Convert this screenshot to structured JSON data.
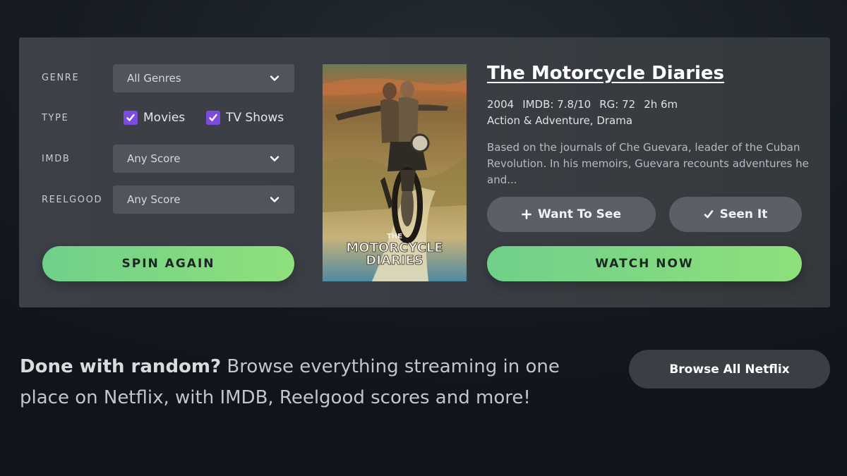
{
  "filters": {
    "genre": {
      "label": "GENRE",
      "value": "All Genres"
    },
    "type": {
      "label": "TYPE",
      "options": [
        {
          "label": "Movies",
          "checked": true
        },
        {
          "label": "TV Shows",
          "checked": true
        }
      ]
    },
    "imdb": {
      "label": "IMDB",
      "value": "Any Score"
    },
    "reelgood": {
      "label": "REELGOOD",
      "value": "Any Score"
    },
    "spin_label": "SPIN AGAIN"
  },
  "movie": {
    "title": "The Motorcycle Diaries",
    "year": "2004",
    "imdb": "IMDB: 7.8/10",
    "rg": "RG: 72",
    "runtime": "2h 6m",
    "genres": "Action & Adventure, Drama",
    "description": "Based on the journals of Che Guevara, leader of the Cuban Revolution. In his memoirs, Guevara recounts adventures he and...",
    "poster_text": {
      "line1": "THE",
      "line2": "MOTORCYCLE",
      "line3": "DIARIES"
    }
  },
  "actions": {
    "want_to_see": "Want To See",
    "seen_it": "Seen It",
    "watch_now": "WATCH NOW"
  },
  "footer": {
    "lead": "Done with random?",
    "text": " Browse everything streaming in one place on Netflix, with IMDB, Reelgood scores and more!",
    "browse_label": "Browse All Netflix"
  },
  "colors": {
    "accent_green": "#7dd982",
    "checkbox_purple": "#7e4be0",
    "panel_bg": "#3c4046"
  },
  "icons": [
    "chevron-down-icon",
    "checkmark-icon",
    "plus-icon"
  ]
}
